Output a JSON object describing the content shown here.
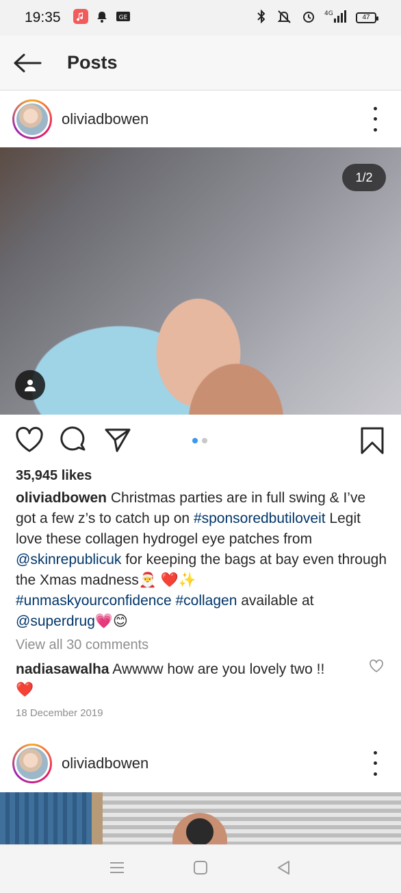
{
  "status_bar": {
    "time": "19:35",
    "battery": "47",
    "network": "4G",
    "icons": [
      "music-app-icon",
      "notification-icon",
      "sim-icon",
      "bluetooth-icon",
      "mute-icon",
      "alarm-icon",
      "signal-icon",
      "battery-icon"
    ]
  },
  "header": {
    "title": "Posts",
    "back_icon": "arrow-left-icon"
  },
  "posts": [
    {
      "username": "oliviadbowen",
      "image_counter": "1/2",
      "likes": "35,945 likes",
      "caption": {
        "username": "oliviadbowen",
        "text1": " Christmas parties are in full swing & I’ve got a few z’s to catch up on ",
        "hashtag1": "#sponsoredbutiloveit",
        "text2": " Legit love these collagen hydrogel eye patches from ",
        "mention1": "@skinrepublicuk",
        "text3": " for keeping the bags at bay even through the Xmas madness",
        "emoji1": "🎅 ❤️✨",
        "hashtag2": "#unmaskyourconfidence",
        "space": " ",
        "hashtag3": "#collagen",
        "text4": " available at ",
        "mention2": "@superdrug",
        "emoji2": "💗😊"
      },
      "view_all_comments": "View all 30 comments",
      "top_comment": {
        "username": "nadiasawalha",
        "text": " Awwww how are you lovely two !!",
        "emoji": "❤️"
      },
      "date": "18 December 2019"
    },
    {
      "username": "oliviadbowen"
    }
  ],
  "colors": {
    "link": "#003569",
    "muted": "#8e8e8e",
    "active_dot": "#3897f0",
    "heart_red": "#e0245e"
  }
}
